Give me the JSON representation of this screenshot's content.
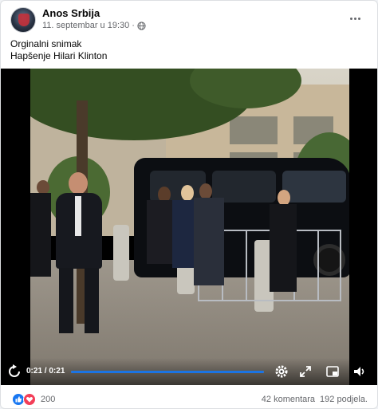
{
  "post": {
    "author": "Anos Srbija",
    "date": "11. septembar u 19:30",
    "separator": "·",
    "privacy_icon": "globe-icon",
    "more_icon": "more-options-icon",
    "text_line_1": "Orginalni snimak",
    "text_line_2": "Hapšenje Hilari Klinton"
  },
  "video": {
    "current_time": "0:21",
    "duration": "0:21",
    "time_separator": " / ",
    "progress": 1.0,
    "icons": [
      "replay-icon",
      "settings-icon",
      "fullscreen-icon",
      "picture-in-picture-icon",
      "volume-icon"
    ]
  },
  "footer": {
    "reactions": [
      "like-icon",
      "love-icon"
    ],
    "reaction_count": "200",
    "comments": "42 komentara",
    "shares": "192 podjela."
  },
  "colors": {
    "accent": "#1b74e4",
    "like": "#1877f2",
    "love": "#f33e58",
    "meta_text": "#65676b"
  }
}
